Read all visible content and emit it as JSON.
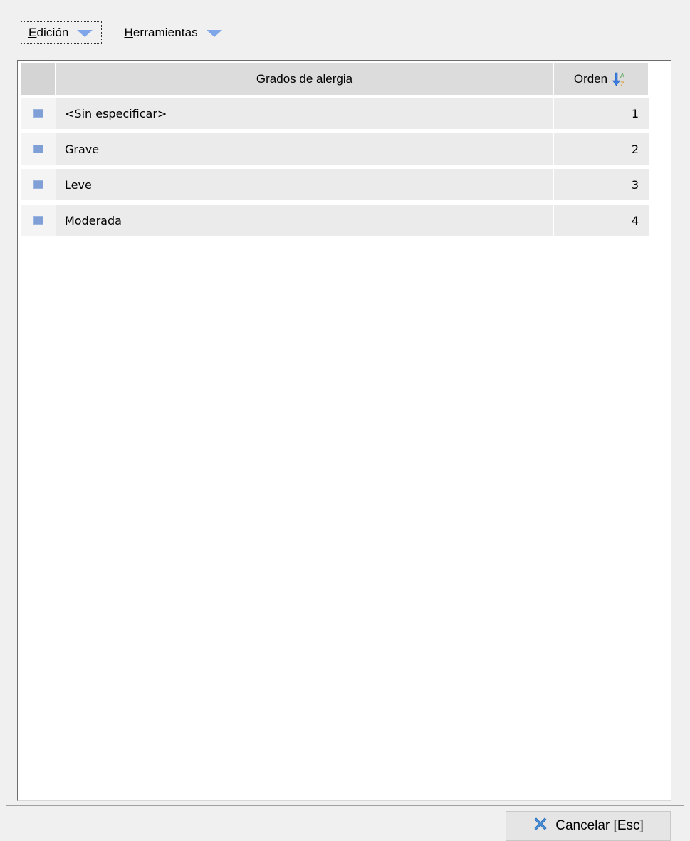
{
  "toolbar": {
    "items": [
      {
        "mnemonic": "E",
        "rest": "dición"
      },
      {
        "mnemonic": "H",
        "rest": "erramientas"
      }
    ]
  },
  "grid": {
    "columns": {
      "name": "Grados de alergia",
      "order": "Orden"
    },
    "sort_icon": "sort-ascending-az-icon",
    "rows": [
      {
        "name": "<Sin especificar>",
        "order": "1"
      },
      {
        "name": "Grave",
        "order": "2"
      },
      {
        "name": "Leve",
        "order": "3"
      },
      {
        "name": "Moderada",
        "order": "4"
      }
    ]
  },
  "footer": {
    "cancel_label": "Cancelar [Esc]"
  },
  "colors": {
    "accent": "#7ea6e8",
    "row_indicator": "#7f9fd6",
    "header_bg": "#dcdcdc",
    "row_bg": "#ebebeb",
    "cancel_icon": "#4a90d9"
  }
}
